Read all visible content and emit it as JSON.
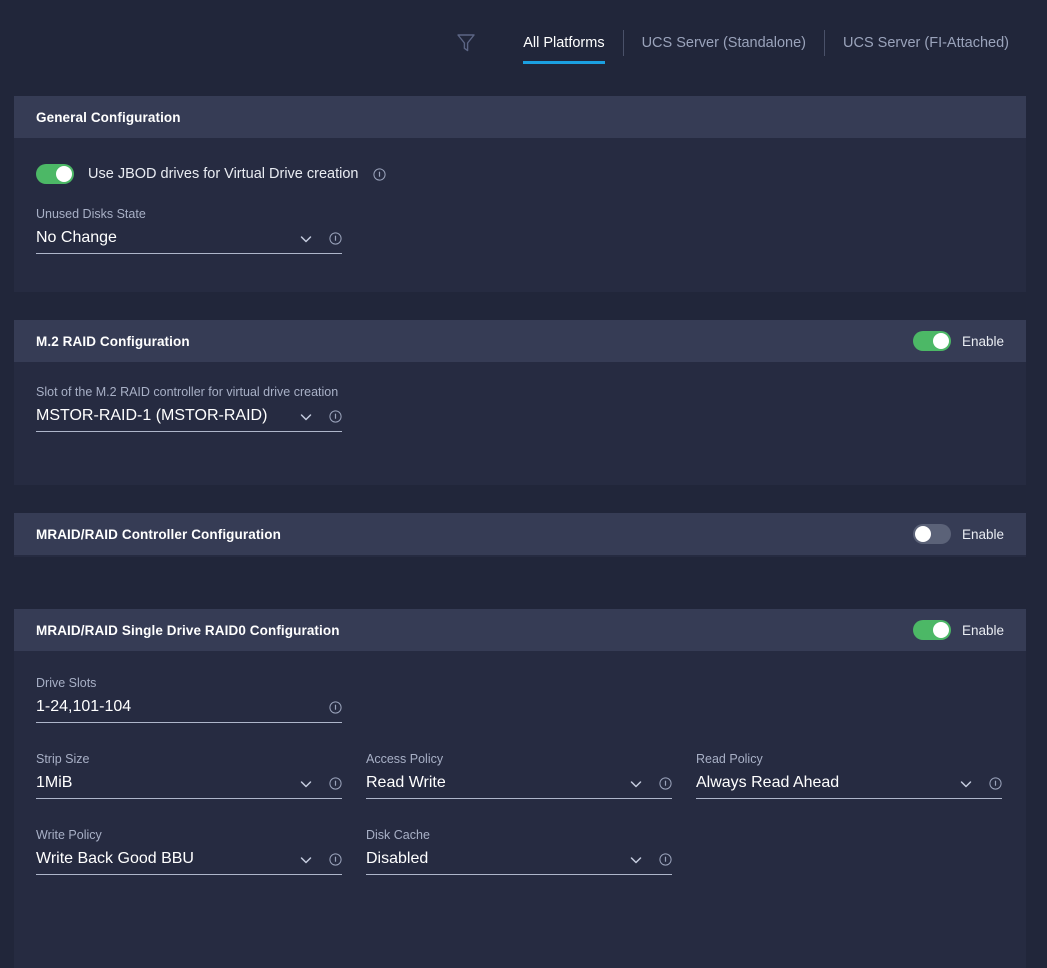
{
  "toolbar": {
    "filter_icon": "filter-icon",
    "tabs": [
      {
        "label": "All Platforms",
        "active": true
      },
      {
        "label": "UCS Server (Standalone)",
        "active": false
      },
      {
        "label": "UCS Server (FI-Attached)",
        "active": false
      }
    ]
  },
  "colors": {
    "page_background": "#21263a",
    "panel_background": "#262b41",
    "section_header_background": "#363c55",
    "accent_underline": "#1ba0e1",
    "toggle_on": "#4cb866",
    "toggle_off": "#5b6278",
    "label_text": "#a8b0c6",
    "value_text": "#ffffff"
  },
  "sections": {
    "general": {
      "title": "General Configuration",
      "jbod_toggle": {
        "label": "Use JBOD drives for Virtual Drive creation",
        "state": "on"
      },
      "unused_disks_state": {
        "label": "Unused Disks State",
        "value": "No Change"
      }
    },
    "m2raid": {
      "title": "M.2 RAID Configuration",
      "enable": {
        "label": "Enable",
        "state": "on"
      },
      "slot": {
        "label": "Slot of the M.2 RAID controller for virtual drive creation",
        "value": "MSTOR-RAID-1 (MSTOR-RAID)"
      }
    },
    "mraid_controller": {
      "title": "MRAID/RAID Controller Configuration",
      "enable": {
        "label": "Enable",
        "state": "off"
      }
    },
    "mraid_single_raid0": {
      "title": "MRAID/RAID Single Drive RAID0 Configuration",
      "enable": {
        "label": "Enable",
        "state": "on"
      },
      "drive_slots": {
        "label": "Drive Slots",
        "value": "1-24,101-104"
      },
      "strip_size": {
        "label": "Strip Size",
        "value": "1MiB"
      },
      "access_policy": {
        "label": "Access Policy",
        "value": "Read Write"
      },
      "read_policy": {
        "label": "Read Policy",
        "value": "Always Read Ahead"
      },
      "write_policy": {
        "label": "Write Policy",
        "value": "Write Back Good BBU"
      },
      "disk_cache": {
        "label": "Disk Cache",
        "value": "Disabled"
      }
    }
  }
}
